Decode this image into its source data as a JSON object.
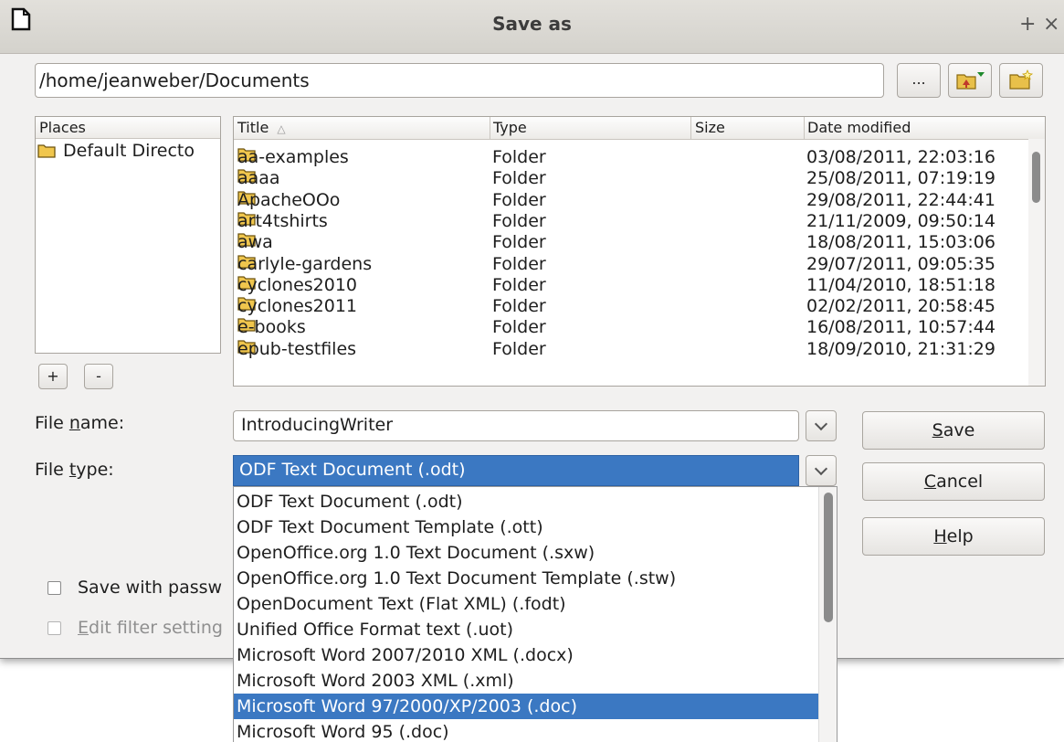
{
  "window": {
    "title": "Save as",
    "pin_glyph": "+",
    "close_glyph": "×"
  },
  "path": {
    "value": "/home/jeanweber/Documents",
    "browse_label": "..."
  },
  "places": {
    "header": "Places",
    "items": [
      "Default Directo"
    ],
    "add_label": "+",
    "remove_label": "-"
  },
  "files": {
    "columns": {
      "title": "Title",
      "sort_glyph": "△",
      "type": "Type",
      "size": "Size",
      "date": "Date modified"
    },
    "rows": [
      {
        "title": "aa-examples",
        "type": "Folder",
        "size": "",
        "date": "03/08/2011, 22:03:16"
      },
      {
        "title": "aaaa",
        "type": "Folder",
        "size": "",
        "date": "25/08/2011, 07:19:19"
      },
      {
        "title": "ApacheOOo",
        "type": "Folder",
        "size": "",
        "date": "29/08/2011, 22:44:41"
      },
      {
        "title": "art4tshirts",
        "type": "Folder",
        "size": "",
        "date": "21/11/2009, 09:50:14"
      },
      {
        "title": "awa",
        "type": "Folder",
        "size": "",
        "date": "18/08/2011, 15:03:06"
      },
      {
        "title": "carlyle-gardens",
        "type": "Folder",
        "size": "",
        "date": "29/07/2011, 09:05:35"
      },
      {
        "title": "cyclones2010",
        "type": "Folder",
        "size": "",
        "date": "11/04/2010, 18:51:18"
      },
      {
        "title": "cyclones2011",
        "type": "Folder",
        "size": "",
        "date": "02/02/2011, 20:58:45"
      },
      {
        "title": "e-books",
        "type": "Folder",
        "size": "",
        "date": "16/08/2011, 10:57:44"
      },
      {
        "title": "epub-testfiles",
        "type": "Folder",
        "size": "",
        "date": "18/09/2010, 21:31:29"
      }
    ]
  },
  "filename": {
    "label_pre": "File ",
    "label_key": "n",
    "label_post": "ame:",
    "value": "IntroducingWriter"
  },
  "filetype": {
    "label_pre": "File ",
    "label_key": "t",
    "label_post": "ype:",
    "value": "ODF Text Document (.odt)",
    "options": [
      "ODF Text Document (.odt)",
      "ODF Text Document Template (.ott)",
      "OpenOffice.org 1.0 Text Document (.sxw)",
      "OpenOffice.org 1.0 Text Document Template (.stw)",
      "OpenDocument Text (Flat XML) (.fodt)",
      "Unified Office Format text (.uot)",
      "Microsoft Word 2007/2010 XML (.docx)",
      "Microsoft Word 2003 XML (.xml)",
      "Microsoft Word 97/2000/XP/2003 (.doc)",
      "Microsoft Word 95 (.doc)"
    ],
    "highlighted_index": 8
  },
  "buttons": {
    "save_key": "S",
    "save_rest": "ave",
    "cancel_key": "C",
    "cancel_rest": "ancel",
    "help_key": "H",
    "help_rest": "elp"
  },
  "options": {
    "password_label": "Save with passw",
    "filter_key": "E",
    "filter_rest": "dit filter setting"
  },
  "colors": {
    "selection": "#3b78c2",
    "dialog_bg": "#f2f1f0"
  },
  "icons": {
    "app": "document-icon",
    "folder": "folder-icon",
    "parent_folder": "folder-up-icon",
    "new_folder": "new-folder-icon"
  }
}
